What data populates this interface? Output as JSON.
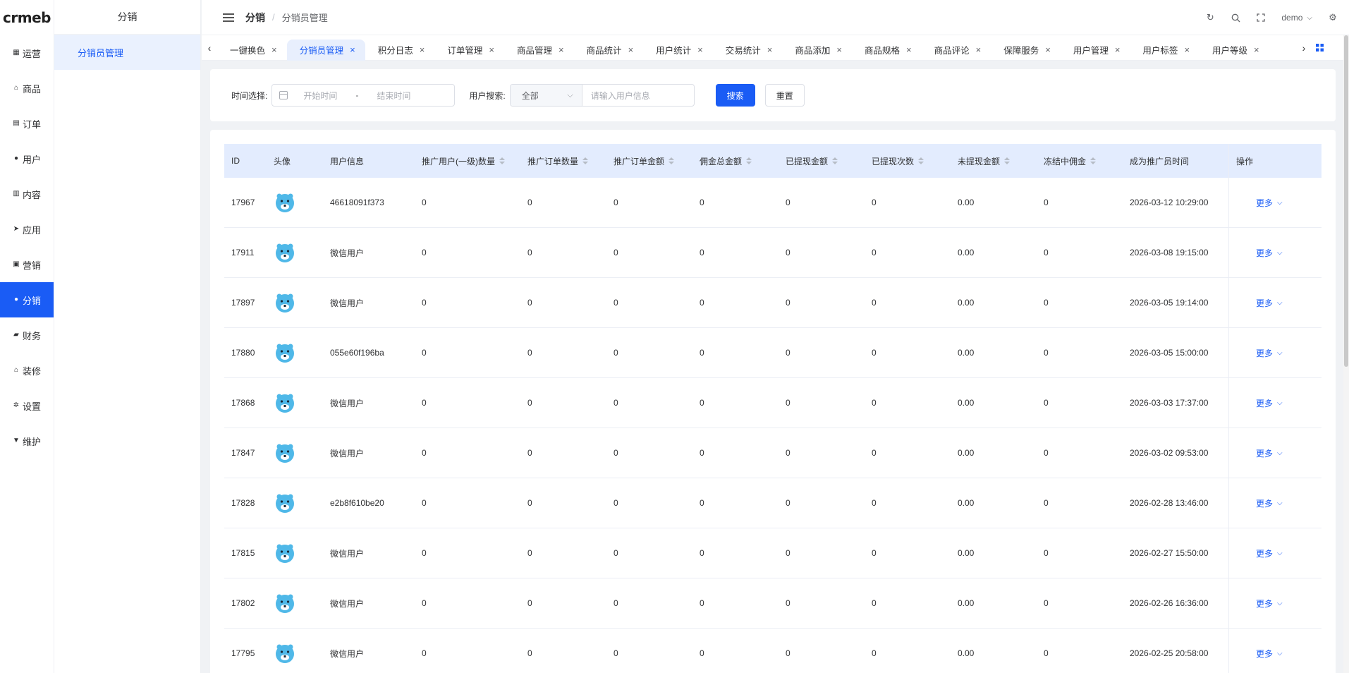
{
  "brand": {
    "logo_text": "crmeb"
  },
  "sidebar": {
    "items": [
      {
        "label": "运营",
        "icon": "grid-icon"
      },
      {
        "label": "商品",
        "icon": "shop-icon"
      },
      {
        "label": "订单",
        "icon": "order-icon"
      },
      {
        "label": "用户",
        "icon": "user-icon"
      },
      {
        "label": "内容",
        "icon": "chart-icon"
      },
      {
        "label": "应用",
        "icon": "send-icon"
      },
      {
        "label": "营销",
        "icon": "marketing-icon"
      },
      {
        "label": "分销",
        "icon": "user-icon",
        "active": true
      },
      {
        "label": "财务",
        "icon": "wallet-icon"
      },
      {
        "label": "装修",
        "icon": "home-icon"
      },
      {
        "label": "设置",
        "icon": "gear-icon"
      },
      {
        "label": "维护",
        "icon": "tools-icon"
      }
    ]
  },
  "submenu": {
    "title": "分销",
    "items": [
      "分销员管理"
    ]
  },
  "header": {
    "breadcrumb_root": "分销",
    "breadcrumb_current": "分销员管理",
    "user": "demo"
  },
  "tabs": [
    {
      "label": "一键换色"
    },
    {
      "label": "分销员管理",
      "active": true
    },
    {
      "label": "积分日志"
    },
    {
      "label": "订单管理"
    },
    {
      "label": "商品管理"
    },
    {
      "label": "商品统计"
    },
    {
      "label": "用户统计"
    },
    {
      "label": "交易统计"
    },
    {
      "label": "商品添加"
    },
    {
      "label": "商品规格"
    },
    {
      "label": "商品评论"
    },
    {
      "label": "保障服务"
    },
    {
      "label": "用户管理"
    },
    {
      "label": "用户标签"
    },
    {
      "label": "用户等级"
    }
  ],
  "search": {
    "time_label": "时间选择:",
    "start_placeholder": "开始时间",
    "range_sep": "-",
    "end_placeholder": "结束时间",
    "user_label": "用户搜索:",
    "select_value": "全部",
    "input_placeholder": "请输入用户信息",
    "search_btn": "搜索",
    "reset_btn": "重置"
  },
  "table": {
    "columns": [
      "ID",
      "头像",
      "用户信息",
      "推广用户(一级)数量",
      "推广订单数量",
      "推广订单金额",
      "佣金总金额",
      "已提现金额",
      "已提现次数",
      "未提现金额",
      "冻结中佣金",
      "成为推广员时间",
      "操作"
    ],
    "more_label": "更多",
    "rows": [
      [
        "17967",
        "46618091f373",
        "0",
        "0",
        "0",
        "0",
        "0",
        "0",
        "0.00",
        "0",
        "2026-03-12 10:29:00"
      ],
      [
        "17911",
        "微信用户",
        "0",
        "0",
        "0",
        "0",
        "0",
        "0",
        "0.00",
        "0",
        "2026-03-08 19:15:00"
      ],
      [
        "17897",
        "微信用户",
        "0",
        "0",
        "0",
        "0",
        "0",
        "0",
        "0.00",
        "0",
        "2026-03-05 19:14:00"
      ],
      [
        "17880",
        "055e60f196ba",
        "0",
        "0",
        "0",
        "0",
        "0",
        "0",
        "0.00",
        "0",
        "2026-03-05 15:00:00"
      ],
      [
        "17868",
        "微信用户",
        "0",
        "0",
        "0",
        "0",
        "0",
        "0",
        "0.00",
        "0",
        "2026-03-03 17:37:00"
      ],
      [
        "17847",
        "微信用户",
        "0",
        "0",
        "0",
        "0",
        "0",
        "0",
        "0.00",
        "0",
        "2026-03-02 09:53:00"
      ],
      [
        "17828",
        "e2b8f610be20",
        "0",
        "0",
        "0",
        "0",
        "0",
        "0",
        "0.00",
        "0",
        "2026-02-28 13:46:00"
      ],
      [
        "17815",
        "微信用户",
        "0",
        "0",
        "0",
        "0",
        "0",
        "0",
        "0.00",
        "0",
        "2026-02-27 15:50:00"
      ],
      [
        "17802",
        "微信用户",
        "0",
        "0",
        "0",
        "0",
        "0",
        "0",
        "0.00",
        "0",
        "2026-02-26 16:36:00"
      ],
      [
        "17795",
        "微信用户",
        "0",
        "0",
        "0",
        "0",
        "0",
        "0",
        "0.00",
        "0",
        "2026-02-25 20:58:00"
      ]
    ]
  },
  "colors": {
    "primary": "#1a5cf5",
    "header_row": "#e3ecfe",
    "avatar": "#4fb8e8"
  }
}
